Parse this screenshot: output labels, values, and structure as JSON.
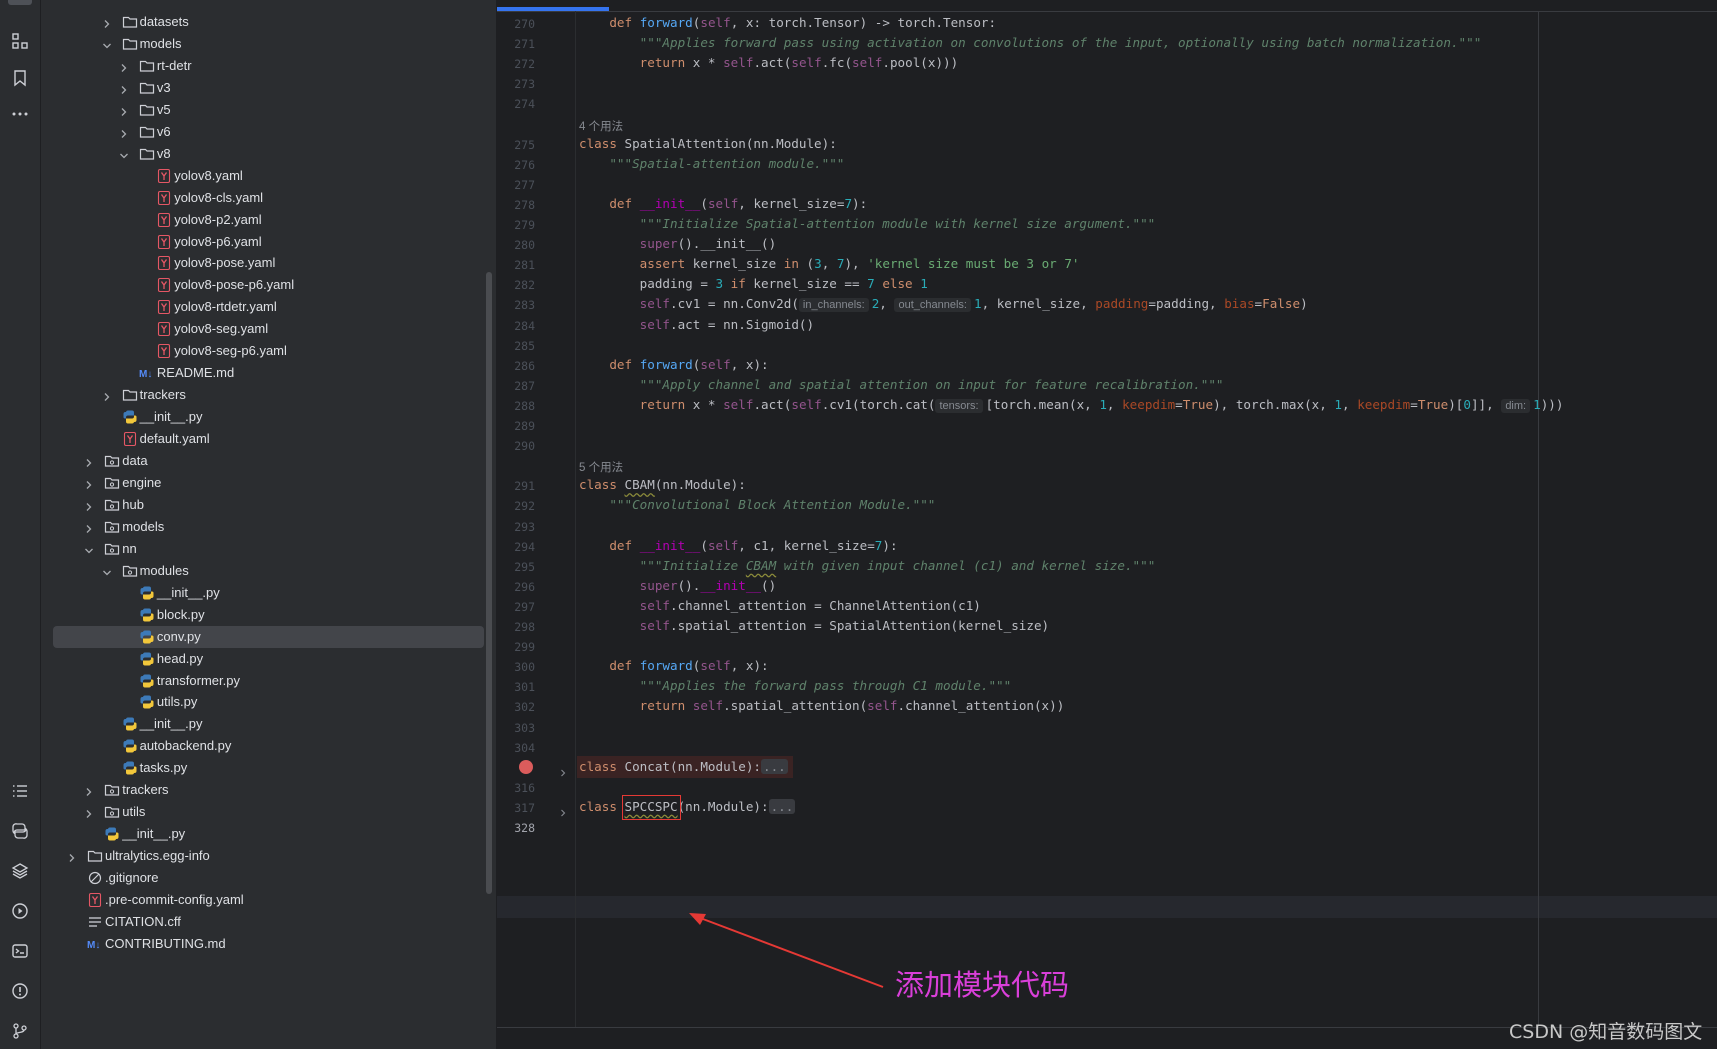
{
  "project_tree": [
    {
      "label": "datasets",
      "type": "folder",
      "depth": 2,
      "open": false
    },
    {
      "label": "models",
      "type": "folder",
      "depth": 2,
      "open": true
    },
    {
      "label": "rt-detr",
      "type": "folder",
      "depth": 3,
      "open": false
    },
    {
      "label": "v3",
      "type": "folder",
      "depth": 3,
      "open": false
    },
    {
      "label": "v5",
      "type": "folder",
      "depth": 3,
      "open": false
    },
    {
      "label": "v6",
      "type": "folder",
      "depth": 3,
      "open": false
    },
    {
      "label": "v8",
      "type": "folder",
      "depth": 3,
      "open": true
    },
    {
      "label": "yolov8.yaml",
      "type": "yaml",
      "depth": 4
    },
    {
      "label": "yolov8-cls.yaml",
      "type": "yaml",
      "depth": 4
    },
    {
      "label": "yolov8-p2.yaml",
      "type": "yaml",
      "depth": 4
    },
    {
      "label": "yolov8-p6.yaml",
      "type": "yaml",
      "depth": 4
    },
    {
      "label": "yolov8-pose.yaml",
      "type": "yaml",
      "depth": 4
    },
    {
      "label": "yolov8-pose-p6.yaml",
      "type": "yaml",
      "depth": 4
    },
    {
      "label": "yolov8-rtdetr.yaml",
      "type": "yaml",
      "depth": 4
    },
    {
      "label": "yolov8-seg.yaml",
      "type": "yaml",
      "depth": 4
    },
    {
      "label": "yolov8-seg-p6.yaml",
      "type": "yaml",
      "depth": 4
    },
    {
      "label": "README.md",
      "type": "md",
      "depth": 3
    },
    {
      "label": "trackers",
      "type": "folder",
      "depth": 2,
      "open": false
    },
    {
      "label": "__init__.py",
      "type": "py",
      "depth": 2
    },
    {
      "label": "default.yaml",
      "type": "yaml",
      "depth": 2
    },
    {
      "label": "data",
      "type": "pkg",
      "depth": 1,
      "open": false
    },
    {
      "label": "engine",
      "type": "pkg",
      "depth": 1,
      "open": false
    },
    {
      "label": "hub",
      "type": "pkg",
      "depth": 1,
      "open": false
    },
    {
      "label": "models",
      "type": "pkg",
      "depth": 1,
      "open": false
    },
    {
      "label": "nn",
      "type": "pkg",
      "depth": 1,
      "open": true
    },
    {
      "label": "modules",
      "type": "pkg",
      "depth": 2,
      "open": true
    },
    {
      "label": "__init__.py",
      "type": "py",
      "depth": 3
    },
    {
      "label": "block.py",
      "type": "py",
      "depth": 3
    },
    {
      "label": "conv.py",
      "type": "py",
      "depth": 3,
      "selected": true
    },
    {
      "label": "head.py",
      "type": "py",
      "depth": 3
    },
    {
      "label": "transformer.py",
      "type": "py",
      "depth": 3
    },
    {
      "label": "utils.py",
      "type": "py",
      "depth": 3
    },
    {
      "label": "__init__.py",
      "type": "py",
      "depth": 2
    },
    {
      "label": "autobackend.py",
      "type": "py",
      "depth": 2
    },
    {
      "label": "tasks.py",
      "type": "py",
      "depth": 2
    },
    {
      "label": "trackers",
      "type": "pkg",
      "depth": 1,
      "open": false
    },
    {
      "label": "utils",
      "type": "pkg",
      "depth": 1,
      "open": false
    },
    {
      "label": "__init__.py",
      "type": "py",
      "depth": 1
    },
    {
      "label": "ultralytics.egg-info",
      "type": "folder",
      "depth": 0,
      "open": false
    },
    {
      "label": ".gitignore",
      "type": "ignore",
      "depth": 0
    },
    {
      "label": ".pre-commit-config.yaml",
      "type": "yaml",
      "depth": 0
    },
    {
      "label": "CITATION.cff",
      "type": "text",
      "depth": 0
    },
    {
      "label": "CONTRIBUTING.md",
      "type": "md",
      "depth": 0
    }
  ],
  "editor": {
    "lines": [
      {
        "n": "270",
        "tokens": [
          [
            "    ",
            ""
          ],
          [
            "def ",
            "kw"
          ],
          [
            "forward",
            "fn"
          ],
          [
            "(",
            ""
          ],
          [
            "self",
            "slf"
          ],
          [
            ", x: torch.Tensor) -> torch.Tensor:",
            ""
          ]
        ]
      },
      {
        "n": "271",
        "tokens": [
          [
            "        ",
            ""
          ],
          [
            "\"\"\"Applies forward pass using activation on convolutions of the input, optionally using batch normalization.\"\"\"",
            "doc"
          ]
        ]
      },
      {
        "n": "272",
        "tokens": [
          [
            "        ",
            ""
          ],
          [
            "return ",
            "kw"
          ],
          [
            "x * ",
            ""
          ],
          [
            "self",
            "slf"
          ],
          [
            ".act(",
            ""
          ],
          [
            "self",
            "slf"
          ],
          [
            ".fc(",
            ""
          ],
          [
            "self",
            "slf"
          ],
          [
            ".pool(x)))",
            ""
          ]
        ]
      },
      {
        "n": "273",
        "tokens": []
      },
      {
        "n": "274",
        "tokens": []
      },
      {
        "usage": "4 个用法"
      },
      {
        "n": "275",
        "tokens": [
          [
            "class ",
            "kw"
          ],
          [
            "SpatialAttention(nn.Module):",
            ""
          ]
        ]
      },
      {
        "n": "276",
        "tokens": [
          [
            "    ",
            ""
          ],
          [
            "\"\"\"Spatial-attention module.\"\"\"",
            "doc"
          ]
        ]
      },
      {
        "n": "277",
        "tokens": []
      },
      {
        "n": "278",
        "tokens": [
          [
            "    ",
            ""
          ],
          [
            "def ",
            "kw"
          ],
          [
            "__init__",
            "dn"
          ],
          [
            "(",
            ""
          ],
          [
            "self",
            "slf"
          ],
          [
            ", kernel_size=",
            ""
          ],
          [
            "7",
            "num"
          ],
          [
            "):",
            ""
          ]
        ]
      },
      {
        "n": "279",
        "tokens": [
          [
            "        ",
            ""
          ],
          [
            "\"\"\"Initialize Spatial-attention module with kernel size argument.\"\"\"",
            "doc"
          ]
        ]
      },
      {
        "n": "280",
        "tokens": [
          [
            "        ",
            ""
          ],
          [
            "super",
            "slf"
          ],
          [
            "().__init__()",
            ""
          ]
        ]
      },
      {
        "n": "281",
        "tokens": [
          [
            "        ",
            ""
          ],
          [
            "assert ",
            "kw"
          ],
          [
            "kernel_size ",
            ""
          ],
          [
            "in ",
            "kw"
          ],
          [
            "(",
            ""
          ],
          [
            "3",
            "num"
          ],
          [
            ", ",
            ""
          ],
          [
            "7",
            "num"
          ],
          [
            "), ",
            ""
          ],
          [
            "'kernel size must be 3 or 7'",
            "str"
          ]
        ]
      },
      {
        "n": "282",
        "tokens": [
          [
            "        padding = ",
            ""
          ],
          [
            "3 ",
            "num"
          ],
          [
            "if ",
            "kw"
          ],
          [
            "kernel_size == ",
            ""
          ],
          [
            "7 ",
            "num"
          ],
          [
            "else ",
            "kw"
          ],
          [
            "1",
            "num"
          ]
        ]
      },
      {
        "n": "283",
        "tokens": [
          [
            "        ",
            ""
          ],
          [
            "self",
            "slf"
          ],
          [
            ".cv1 = nn.Conv2d(",
            ""
          ],
          [
            "in_channels:",
            "hint"
          ],
          [
            "2",
            "num"
          ],
          [
            ", ",
            ""
          ],
          [
            "out_channels:",
            "hint"
          ],
          [
            "1",
            "num"
          ],
          [
            ", kernel_size, ",
            ""
          ],
          [
            "padding",
            "kwarg"
          ],
          [
            "=padding, ",
            ""
          ],
          [
            "bias",
            "kwarg"
          ],
          [
            "=",
            ""
          ],
          [
            "False",
            "kw"
          ],
          [
            ")",
            ""
          ]
        ]
      },
      {
        "n": "284",
        "tokens": [
          [
            "        ",
            ""
          ],
          [
            "self",
            "slf"
          ],
          [
            ".act = nn.Sigmoid()",
            ""
          ]
        ]
      },
      {
        "n": "285",
        "tokens": []
      },
      {
        "n": "286",
        "tokens": [
          [
            "    ",
            ""
          ],
          [
            "def ",
            "kw"
          ],
          [
            "forward",
            "fn"
          ],
          [
            "(",
            ""
          ],
          [
            "self",
            "slf"
          ],
          [
            ", x):",
            ""
          ]
        ]
      },
      {
        "n": "287",
        "tokens": [
          [
            "        ",
            ""
          ],
          [
            "\"\"\"Apply channel and spatial attention on input for feature recalibration.\"\"\"",
            "doc"
          ]
        ]
      },
      {
        "n": "288",
        "tokens": [
          [
            "        ",
            ""
          ],
          [
            "return ",
            "kw"
          ],
          [
            "x * ",
            ""
          ],
          [
            "self",
            "slf"
          ],
          [
            ".act(",
            ""
          ],
          [
            "self",
            "slf"
          ],
          [
            ".cv1(torch.cat(",
            ""
          ],
          [
            "tensors:",
            "hint"
          ],
          [
            "[torch.mean(x, ",
            ""
          ],
          [
            "1",
            "num"
          ],
          [
            ", ",
            ""
          ],
          [
            "keepdim",
            "kwarg"
          ],
          [
            "=",
            ""
          ],
          [
            "True",
            "kw"
          ],
          [
            "), torch.max(x, ",
            ""
          ],
          [
            "1",
            "num"
          ],
          [
            ", ",
            ""
          ],
          [
            "keepdim",
            "kwarg"
          ],
          [
            "=",
            ""
          ],
          [
            "True",
            "kw"
          ],
          [
            ")[",
            ""
          ],
          [
            "0",
            "num"
          ],
          [
            "]], ",
            ""
          ],
          [
            "dim:",
            "hint"
          ],
          [
            "1",
            "num"
          ],
          [
            ")))",
            ""
          ]
        ]
      },
      {
        "n": "289",
        "tokens": []
      },
      {
        "n": "290",
        "tokens": []
      },
      {
        "usage": "5 个用法"
      },
      {
        "n": "291",
        "tokens": [
          [
            "class ",
            "kw"
          ],
          [
            "CBAM",
            "warn"
          ],
          [
            "(nn.Module):",
            ""
          ]
        ]
      },
      {
        "n": "292",
        "tokens": [
          [
            "    ",
            ""
          ],
          [
            "\"\"\"Convolutional Block Attention Module.\"\"\"",
            "doc"
          ]
        ]
      },
      {
        "n": "293",
        "tokens": []
      },
      {
        "n": "294",
        "tokens": [
          [
            "    ",
            ""
          ],
          [
            "def ",
            "kw"
          ],
          [
            "__init__",
            "dn"
          ],
          [
            "(",
            ""
          ],
          [
            "self",
            "slf"
          ],
          [
            ", c1, kernel_size=",
            ""
          ],
          [
            "7",
            "num"
          ],
          [
            "):",
            ""
          ]
        ]
      },
      {
        "n": "295",
        "tokens": [
          [
            "        ",
            ""
          ],
          [
            "\"\"\"Initialize ",
            "doc"
          ],
          [
            "CBAM",
            "docwarn"
          ],
          [
            " with given input channel (c1) and kernel size.\"\"\"",
            "doc"
          ]
        ]
      },
      {
        "n": "296",
        "tokens": [
          [
            "        ",
            ""
          ],
          [
            "super",
            "slf"
          ],
          [
            "().",
            ""
          ],
          [
            "__init__",
            "dn"
          ],
          [
            "()",
            ""
          ]
        ]
      },
      {
        "n": "297",
        "tokens": [
          [
            "        ",
            ""
          ],
          [
            "self",
            "slf"
          ],
          [
            ".channel_attention = ChannelAttention(c1)",
            ""
          ]
        ]
      },
      {
        "n": "298",
        "tokens": [
          [
            "        ",
            ""
          ],
          [
            "self",
            "slf"
          ],
          [
            ".spatial_attention = SpatialAttention(kernel_size)",
            ""
          ]
        ]
      },
      {
        "n": "299",
        "tokens": []
      },
      {
        "n": "300",
        "tokens": [
          [
            "    ",
            ""
          ],
          [
            "def ",
            "kw"
          ],
          [
            "forward",
            "fn"
          ],
          [
            "(",
            ""
          ],
          [
            "self",
            "slf"
          ],
          [
            ", x):",
            ""
          ]
        ]
      },
      {
        "n": "301",
        "tokens": [
          [
            "        ",
            ""
          ],
          [
            "\"\"\"Applies the forward pass through C1 module.\"\"\"",
            "doc"
          ]
        ]
      },
      {
        "n": "302",
        "tokens": [
          [
            "        ",
            ""
          ],
          [
            "return ",
            "kw"
          ],
          [
            "self",
            "slf"
          ],
          [
            ".spatial_attention(",
            ""
          ],
          [
            "self",
            "slf"
          ],
          [
            ".channel_attention(x))",
            ""
          ]
        ]
      },
      {
        "n": "303",
        "tokens": []
      },
      {
        "n": "304",
        "tokens": []
      },
      {
        "n": "",
        "fold": true,
        "breakpoint": true,
        "tokens": [
          [
            "class ",
            "kw"
          ],
          [
            "Concat(nn.Module):",
            ""
          ],
          [
            "...",
            "fold"
          ]
        ]
      },
      {
        "n": "316",
        "tokens": []
      },
      {
        "n": "317",
        "fold": true,
        "tokens": [
          [
            "class ",
            "kw"
          ],
          [
            "SPCCSPC",
            "warn"
          ],
          [
            "(nn.Module):",
            ""
          ],
          [
            "...",
            "fold"
          ]
        ]
      },
      {
        "n": "328",
        "current": true,
        "tokens": []
      }
    ]
  },
  "annotation": {
    "text": "添加模块代码",
    "color": "#d93fd9"
  },
  "watermark": "CSDN @知音数码图文",
  "colors": {
    "accent": "#3574f0",
    "breakpoint": "#db5c5c",
    "highlight_box": "#e53935"
  }
}
